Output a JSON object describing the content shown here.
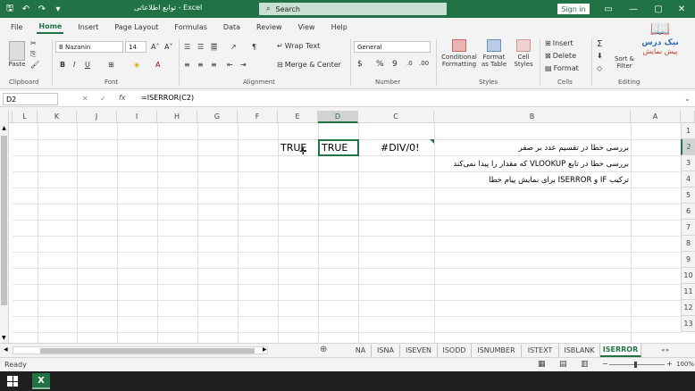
{
  "titlebar": {
    "title": "توابع اطلاعاتی - Excel",
    "search": "Search",
    "signin": "Sign in"
  },
  "menu": [
    "File",
    "Home",
    "Insert",
    "Page Layout",
    "Formulas",
    "Data",
    "Review",
    "View",
    "Help"
  ],
  "ribbon": {
    "paste": "Paste",
    "font_name": "B Nazanin",
    "font_size": "14",
    "wrap_text": "Wrap Text",
    "merge_center": "Merge & Center",
    "number_format": "General",
    "conditional": "Conditional Formatting",
    "format_table": "Format as Table",
    "cell_styles": "Cell Styles",
    "insert": "Insert",
    "delete": "Delete",
    "format": "Format",
    "sort_filter": "Sort & Filter",
    "groups": [
      "Clipboard",
      "Font",
      "Alignment",
      "Number",
      "Styles",
      "Cells",
      "Editing"
    ]
  },
  "formula_bar": {
    "name_box": "D2",
    "fx": "fx",
    "formula": "=ISERROR(C2)"
  },
  "columns": [
    "L",
    "K",
    "J",
    "I",
    "H",
    "G",
    "F",
    "E",
    "D",
    "C",
    "B",
    "A"
  ],
  "rows": [
    "1",
    "2",
    "3",
    "4",
    "5",
    "6",
    "7",
    "8",
    "9",
    "10",
    "11",
    "12",
    "13"
  ],
  "cells": {
    "E2": "TRUE",
    "D2": "TRUE",
    "C2": "#DIV/0!",
    "B2": "بررسی خطا در تقسیم عدد بر صفر",
    "B3": "بررسی خطا در تابع VLOOKUP که مقدار را پیدا نمی‌کند",
    "B4": "ترکیب IF و ISERROR برای نمایش پیام خطا"
  },
  "sheets": [
    "NA",
    "ISNA",
    "ISEVEN",
    "ISODD",
    "ISNUMBER",
    "ISTEXT",
    "ISBLANK",
    "ISERROR"
  ],
  "active_sheet": "ISERROR",
  "status": {
    "ready": "Ready",
    "zoom": "100%"
  },
  "logo": {
    "line1": "نیک درس",
    "line2": "پیش نمایش"
  },
  "colors": {
    "accent": "#217346"
  }
}
